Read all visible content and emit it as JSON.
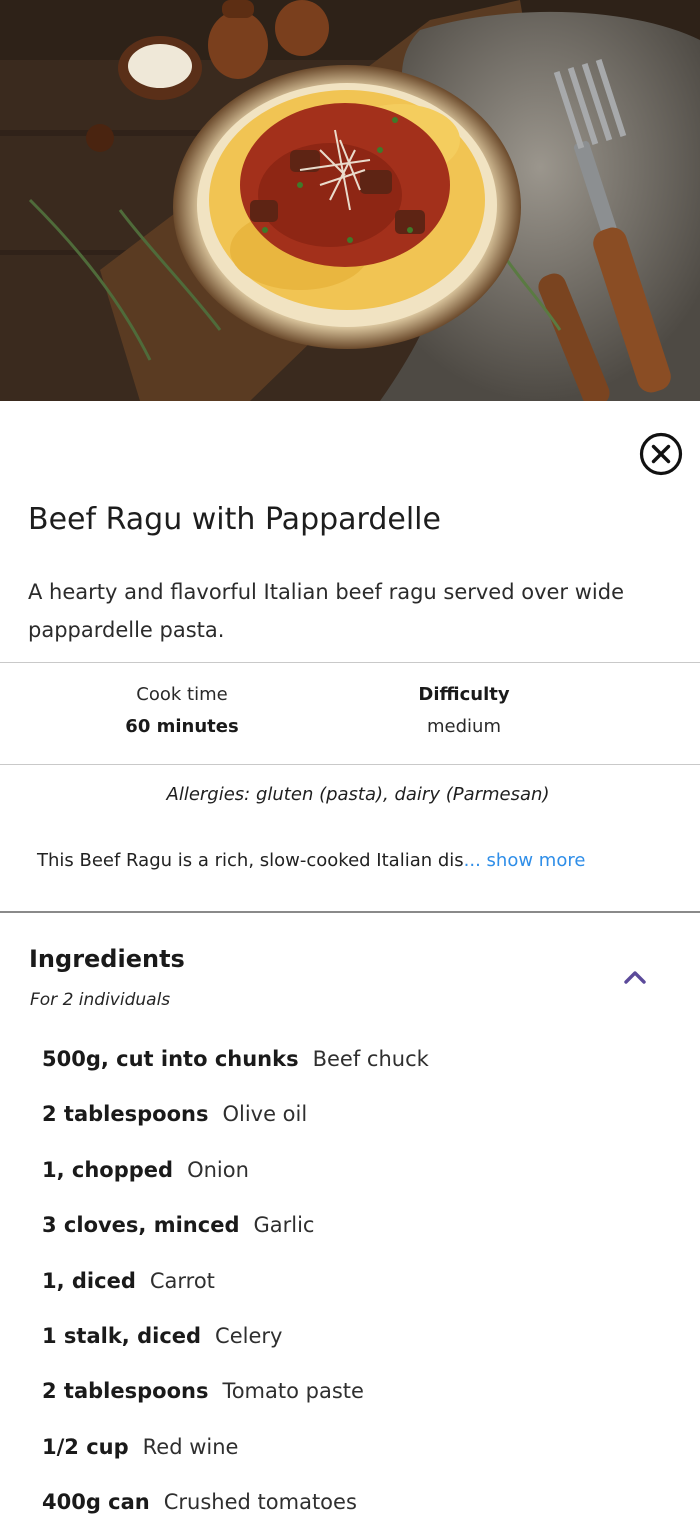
{
  "recipe": {
    "title": "Beef Ragu with Pappardelle",
    "description": "A hearty and flavorful Italian beef ragu served over wide pappardelle pasta.",
    "cook_time_label": "Cook time",
    "cook_time_value": "60 minutes",
    "difficulty_label": "Difficulty",
    "difficulty_value": "medium",
    "allergies": "Allergies: gluten (pasta), dairy (Parmesan)",
    "summary": "This Beef Ragu is a rich, slow-cooked Italian dis",
    "show_more": "... show more"
  },
  "ingredients": {
    "title": "Ingredients",
    "serving_note": "For 2 individuals",
    "items": [
      {
        "qty": "500g, cut into chunks",
        "name": "Beef chuck"
      },
      {
        "qty": "2 tablespoons",
        "name": "Olive oil"
      },
      {
        "qty": "1, chopped",
        "name": "Onion"
      },
      {
        "qty": "3 cloves, minced",
        "name": "Garlic"
      },
      {
        "qty": "1, diced",
        "name": "Carrot"
      },
      {
        "qty": "1 stalk, diced",
        "name": "Celery"
      },
      {
        "qty": "2 tablespoons",
        "name": "Tomato paste"
      },
      {
        "qty": "1/2 cup",
        "name": "Red wine"
      },
      {
        "qty": "400g can",
        "name": "Crushed tomatoes"
      }
    ]
  },
  "colors": {
    "link": "#2f8ee8",
    "chevron": "#5b4a9a",
    "divider": "#c9c9c9"
  },
  "icons": {
    "close": "close-circle-icon",
    "collapse": "chevron-up-icon"
  }
}
